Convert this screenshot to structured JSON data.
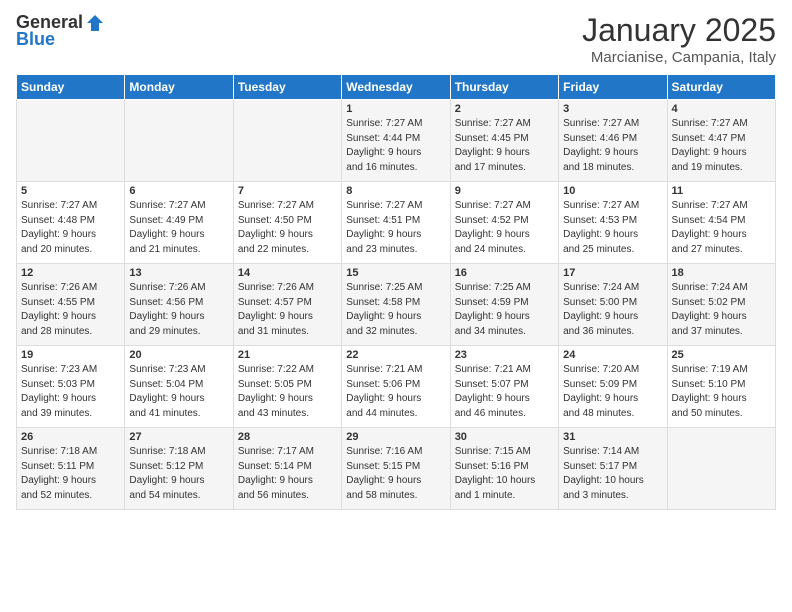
{
  "logo": {
    "general": "General",
    "blue": "Blue"
  },
  "title": "January 2025",
  "location": "Marcianise, Campania, Italy",
  "weekdays": [
    "Sunday",
    "Monday",
    "Tuesday",
    "Wednesday",
    "Thursday",
    "Friday",
    "Saturday"
  ],
  "weeks": [
    [
      {
        "day": "",
        "info": ""
      },
      {
        "day": "",
        "info": ""
      },
      {
        "day": "",
        "info": ""
      },
      {
        "day": "1",
        "info": "Sunrise: 7:27 AM\nSunset: 4:44 PM\nDaylight: 9 hours\nand 16 minutes."
      },
      {
        "day": "2",
        "info": "Sunrise: 7:27 AM\nSunset: 4:45 PM\nDaylight: 9 hours\nand 17 minutes."
      },
      {
        "day": "3",
        "info": "Sunrise: 7:27 AM\nSunset: 4:46 PM\nDaylight: 9 hours\nand 18 minutes."
      },
      {
        "day": "4",
        "info": "Sunrise: 7:27 AM\nSunset: 4:47 PM\nDaylight: 9 hours\nand 19 minutes."
      }
    ],
    [
      {
        "day": "5",
        "info": "Sunrise: 7:27 AM\nSunset: 4:48 PM\nDaylight: 9 hours\nand 20 minutes."
      },
      {
        "day": "6",
        "info": "Sunrise: 7:27 AM\nSunset: 4:49 PM\nDaylight: 9 hours\nand 21 minutes."
      },
      {
        "day": "7",
        "info": "Sunrise: 7:27 AM\nSunset: 4:50 PM\nDaylight: 9 hours\nand 22 minutes."
      },
      {
        "day": "8",
        "info": "Sunrise: 7:27 AM\nSunset: 4:51 PM\nDaylight: 9 hours\nand 23 minutes."
      },
      {
        "day": "9",
        "info": "Sunrise: 7:27 AM\nSunset: 4:52 PM\nDaylight: 9 hours\nand 24 minutes."
      },
      {
        "day": "10",
        "info": "Sunrise: 7:27 AM\nSunset: 4:53 PM\nDaylight: 9 hours\nand 25 minutes."
      },
      {
        "day": "11",
        "info": "Sunrise: 7:27 AM\nSunset: 4:54 PM\nDaylight: 9 hours\nand 27 minutes."
      }
    ],
    [
      {
        "day": "12",
        "info": "Sunrise: 7:26 AM\nSunset: 4:55 PM\nDaylight: 9 hours\nand 28 minutes."
      },
      {
        "day": "13",
        "info": "Sunrise: 7:26 AM\nSunset: 4:56 PM\nDaylight: 9 hours\nand 29 minutes."
      },
      {
        "day": "14",
        "info": "Sunrise: 7:26 AM\nSunset: 4:57 PM\nDaylight: 9 hours\nand 31 minutes."
      },
      {
        "day": "15",
        "info": "Sunrise: 7:25 AM\nSunset: 4:58 PM\nDaylight: 9 hours\nand 32 minutes."
      },
      {
        "day": "16",
        "info": "Sunrise: 7:25 AM\nSunset: 4:59 PM\nDaylight: 9 hours\nand 34 minutes."
      },
      {
        "day": "17",
        "info": "Sunrise: 7:24 AM\nSunset: 5:00 PM\nDaylight: 9 hours\nand 36 minutes."
      },
      {
        "day": "18",
        "info": "Sunrise: 7:24 AM\nSunset: 5:02 PM\nDaylight: 9 hours\nand 37 minutes."
      }
    ],
    [
      {
        "day": "19",
        "info": "Sunrise: 7:23 AM\nSunset: 5:03 PM\nDaylight: 9 hours\nand 39 minutes."
      },
      {
        "day": "20",
        "info": "Sunrise: 7:23 AM\nSunset: 5:04 PM\nDaylight: 9 hours\nand 41 minutes."
      },
      {
        "day": "21",
        "info": "Sunrise: 7:22 AM\nSunset: 5:05 PM\nDaylight: 9 hours\nand 43 minutes."
      },
      {
        "day": "22",
        "info": "Sunrise: 7:21 AM\nSunset: 5:06 PM\nDaylight: 9 hours\nand 44 minutes."
      },
      {
        "day": "23",
        "info": "Sunrise: 7:21 AM\nSunset: 5:07 PM\nDaylight: 9 hours\nand 46 minutes."
      },
      {
        "day": "24",
        "info": "Sunrise: 7:20 AM\nSunset: 5:09 PM\nDaylight: 9 hours\nand 48 minutes."
      },
      {
        "day": "25",
        "info": "Sunrise: 7:19 AM\nSunset: 5:10 PM\nDaylight: 9 hours\nand 50 minutes."
      }
    ],
    [
      {
        "day": "26",
        "info": "Sunrise: 7:18 AM\nSunset: 5:11 PM\nDaylight: 9 hours\nand 52 minutes."
      },
      {
        "day": "27",
        "info": "Sunrise: 7:18 AM\nSunset: 5:12 PM\nDaylight: 9 hours\nand 54 minutes."
      },
      {
        "day": "28",
        "info": "Sunrise: 7:17 AM\nSunset: 5:14 PM\nDaylight: 9 hours\nand 56 minutes."
      },
      {
        "day": "29",
        "info": "Sunrise: 7:16 AM\nSunset: 5:15 PM\nDaylight: 9 hours\nand 58 minutes."
      },
      {
        "day": "30",
        "info": "Sunrise: 7:15 AM\nSunset: 5:16 PM\nDaylight: 10 hours\nand 1 minute."
      },
      {
        "day": "31",
        "info": "Sunrise: 7:14 AM\nSunset: 5:17 PM\nDaylight: 10 hours\nand 3 minutes."
      },
      {
        "day": "",
        "info": ""
      }
    ]
  ]
}
